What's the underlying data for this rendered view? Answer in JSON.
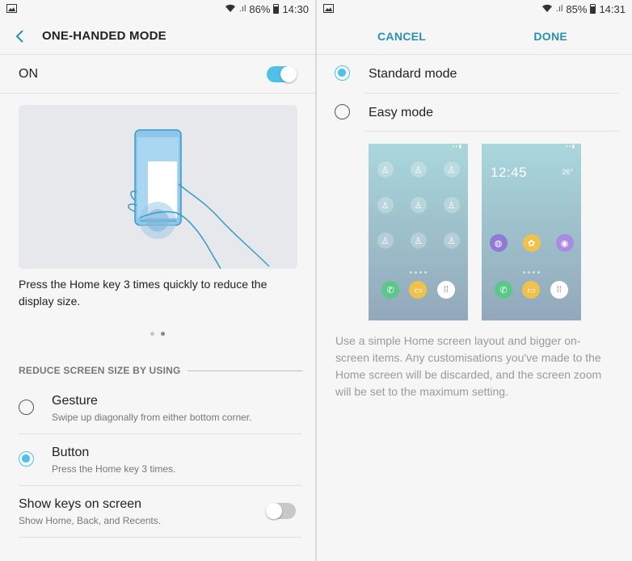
{
  "left": {
    "status": {
      "time": "14:30",
      "battery": "86%"
    },
    "header": {
      "title": "ONE-HANDED MODE"
    },
    "main_toggle": {
      "label": "ON",
      "state": "on"
    },
    "illustration_caption": "Press the Home key 3 times quickly to reduce the display size.",
    "pager": {
      "count": 2,
      "active_index": 1
    },
    "section_title": "REDUCE SCREEN SIZE BY USING",
    "options": [
      {
        "title": "Gesture",
        "subtitle": "Swipe up diagonally from either bottom corner.",
        "selected": false
      },
      {
        "title": "Button",
        "subtitle": "Press the Home key 3 times.",
        "selected": true
      }
    ],
    "show_keys": {
      "title": "Show keys on screen",
      "subtitle": "Show Home, Back, and Recents.",
      "state": "off"
    }
  },
  "right": {
    "status": {
      "time": "14:31",
      "battery": "85%"
    },
    "actions": {
      "cancel": "CANCEL",
      "done": "DONE"
    },
    "modes": [
      {
        "label": "Standard mode",
        "selected": true
      },
      {
        "label": "Easy mode",
        "selected": false
      }
    ],
    "easy_preview": {
      "clock": "12:45",
      "weather": "26°"
    },
    "description": "Use a simple Home screen layout and bigger on-screen items. Any customisations you've made to the Home screen will be discarded, and the screen zoom will be set to the maximum setting."
  },
  "colors": {
    "accent": "#4fc1e9",
    "link": "#2a8fb5"
  },
  "icons": [
    "image-icon",
    "wifi-icon",
    "signal-icon",
    "battery-icon",
    "back-arrow-icon",
    "contact-add-icon",
    "phone-icon",
    "message-icon",
    "apps-icon",
    "internet-icon",
    "gallery-icon",
    "camera-icon"
  ]
}
